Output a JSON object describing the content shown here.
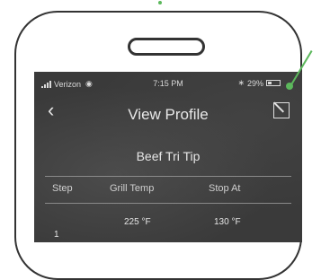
{
  "status_bar": {
    "carrier": "Verizon",
    "time": "7:15 PM",
    "battery": "29%"
  },
  "nav": {
    "back_icon": "chevron-left-icon",
    "title": "View Profile",
    "edit_icon": "edit-icon"
  },
  "profile": {
    "name": "Beef Tri Tip"
  },
  "table": {
    "columns": [
      "Step",
      "Grill Temp",
      "Stop At"
    ],
    "rows": [
      {
        "step": "1",
        "grill_temp": "225 °F",
        "stop_at": "130 °F"
      }
    ]
  },
  "colors": {
    "accent": "#5cb85c",
    "screen_bg": "#3a3a3a",
    "device_outline": "#333333"
  }
}
